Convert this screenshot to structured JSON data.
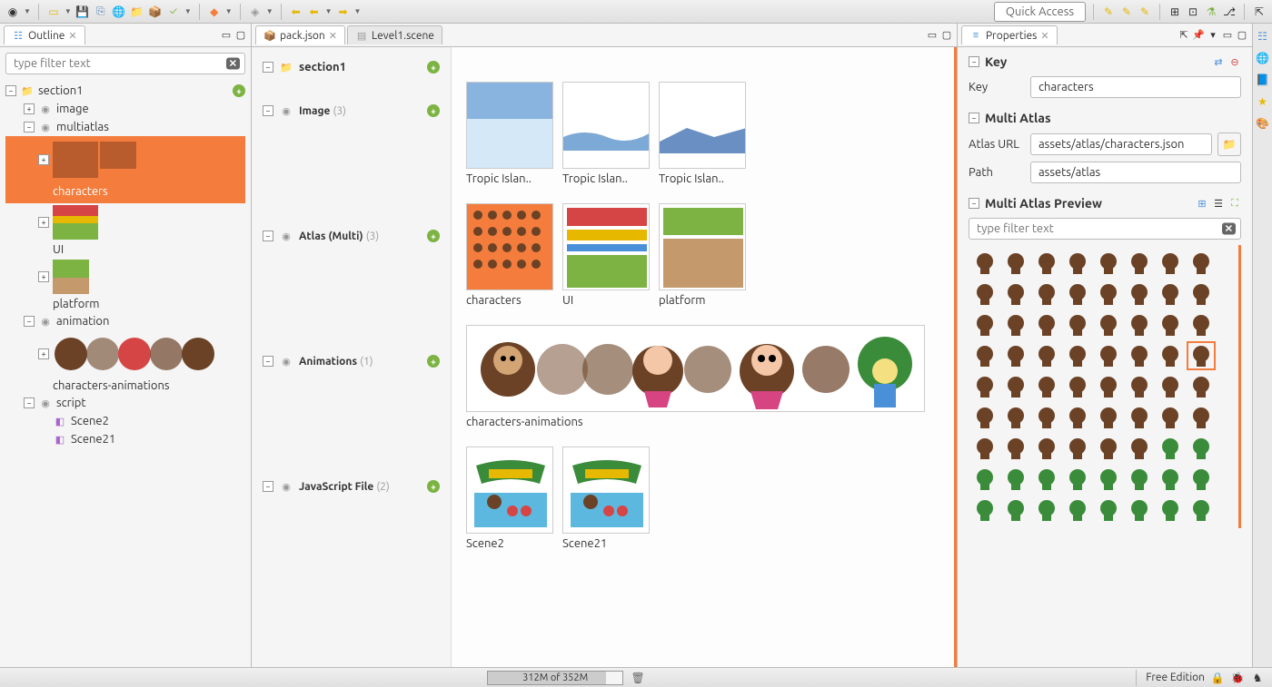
{
  "toolbar": {
    "quick_access": "Quick Access"
  },
  "outline": {
    "title": "Outline",
    "filter_placeholder": "type filter text",
    "tree": {
      "section1": "section1",
      "image": "image",
      "multiatlas": "multiatlas",
      "characters": "characters",
      "ui": "UI",
      "platform": "platform",
      "animation": "animation",
      "characters_animations": "characters-animations",
      "script": "script",
      "scene2": "Scene2",
      "scene21": "Scene21"
    }
  },
  "editor": {
    "tabs": {
      "pack": "pack.json",
      "level1": "Level1.scene"
    },
    "sections": {
      "section1": "section1",
      "image": "Image",
      "image_count": "(3)",
      "atlas": "Atlas (Multi)",
      "atlas_count": "(3)",
      "animations": "Animations",
      "animations_count": "(1)",
      "js": "JavaScript File",
      "js_count": "(2)"
    },
    "assets": {
      "tropic1": "Tropic Islan..",
      "tropic2": "Tropic Islan..",
      "tropic3": "Tropic Islan..",
      "characters": "characters",
      "ui": "UI",
      "platform": "platform",
      "char_anim": "characters-animations",
      "scene2": "Scene2",
      "scene21": "Scene21"
    }
  },
  "properties": {
    "title": "Properties",
    "key_section": "Key",
    "key_label": "Key",
    "key_value": "characters",
    "multiatlas_section": "Multi Atlas",
    "atlas_url_label": "Atlas URL",
    "atlas_url_value": "assets/atlas/characters.json",
    "path_label": "Path",
    "path_value": "assets/atlas",
    "preview_section": "Multi Atlas Preview",
    "preview_filter": "type filter text"
  },
  "status": {
    "memory": "312M of 352M",
    "edition": "Free Edition"
  }
}
